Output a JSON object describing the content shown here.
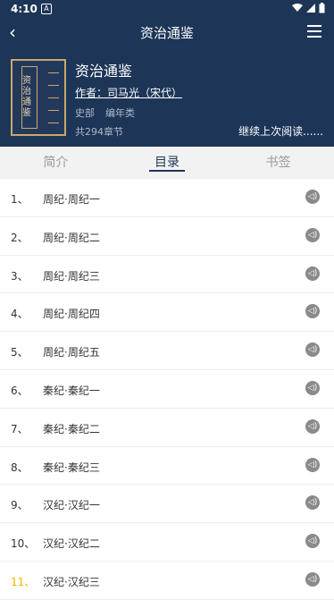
{
  "status": {
    "time": "4:10",
    "notif_glyph": "A"
  },
  "toolbar": {
    "title": "资治通鉴"
  },
  "book": {
    "title": "资治通鉴",
    "cover_title": "资治通鉴",
    "author": "作者：司马光（宋代）",
    "category": "史部",
    "subcategory": "编年类",
    "chapter_count": "共294章节",
    "continue_label": "继续上次阅读......"
  },
  "tabs": [
    {
      "label": "简介"
    },
    {
      "label": "目录"
    },
    {
      "label": "书签"
    }
  ],
  "chapters": [
    {
      "num": "1、",
      "name": "周纪·周纪一"
    },
    {
      "num": "2、",
      "name": "周纪·周纪二"
    },
    {
      "num": "3、",
      "name": "周纪·周纪三"
    },
    {
      "num": "4、",
      "name": "周纪·周纪四"
    },
    {
      "num": "5、",
      "name": "周纪·周纪五"
    },
    {
      "num": "6、",
      "name": "秦纪·秦纪一"
    },
    {
      "num": "7、",
      "name": "秦纪·秦纪二"
    },
    {
      "num": "8、",
      "name": "秦纪·秦纪三"
    },
    {
      "num": "9、",
      "name": "汉纪·汉纪一"
    },
    {
      "num": "10、",
      "name": "汉纪·汉纪二"
    },
    {
      "num": "11、",
      "name": "汉纪·汉纪三"
    }
  ],
  "colors": {
    "header": "#1d3557",
    "current_chapter": "#f0b400",
    "accent_gold": "#c9a76a"
  }
}
